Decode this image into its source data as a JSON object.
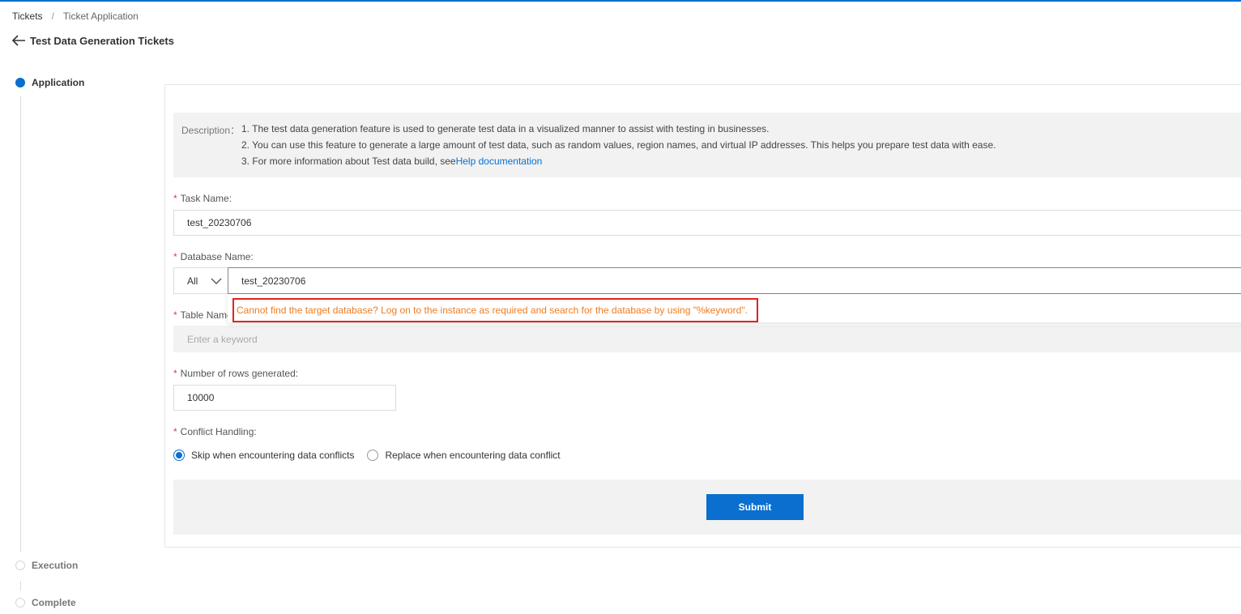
{
  "breadcrumb": {
    "root": "Tickets",
    "separator": "/",
    "current": "Ticket Application"
  },
  "page": {
    "title": "Test Data Generation Tickets",
    "back_icon": "arrow-left-icon"
  },
  "steps": [
    {
      "label": "Application",
      "state": "active"
    },
    {
      "label": "Execution",
      "state": "pending"
    },
    {
      "label": "Complete",
      "state": "pending"
    }
  ],
  "description": {
    "label": "Description：",
    "line1": "1. The test data generation feature is used to generate test data in a visualized manner to assist with testing in businesses.",
    "line2": "2. You can use this feature to generate a large amount of test data, such as random values, region names, and virtual IP addresses. This helps you prepare test data with ease.",
    "line3_prefix": "3. For more information about Test data build, see",
    "line3_link": "Help documentation"
  },
  "form": {
    "required_mark": "*",
    "task_name_label": "Task Name:",
    "task_name_value": "test_20230706",
    "database_label": "Database Name:",
    "database_scope": "All",
    "database_value": "test_20230706",
    "database_hint": "Cannot find the target database? Log on to the instance as required and search for the database by using \"%keyword\".",
    "table_label": "Table Name",
    "table_placeholder": "Enter a keyword",
    "rows_label": "Number of rows generated:",
    "rows_value": "10000",
    "conflict_label": "Conflict Handling:",
    "conflict_options": [
      {
        "label": "Skip when encountering data conflicts",
        "checked": true
      },
      {
        "label": "Replace when encountering data conflict",
        "checked": false
      }
    ],
    "submit_label": "Submit"
  },
  "colors": {
    "accent": "#0a6fcf",
    "warning_text": "#f07c1f",
    "highlight_border": "#e4211e",
    "required": "#e4393c"
  }
}
